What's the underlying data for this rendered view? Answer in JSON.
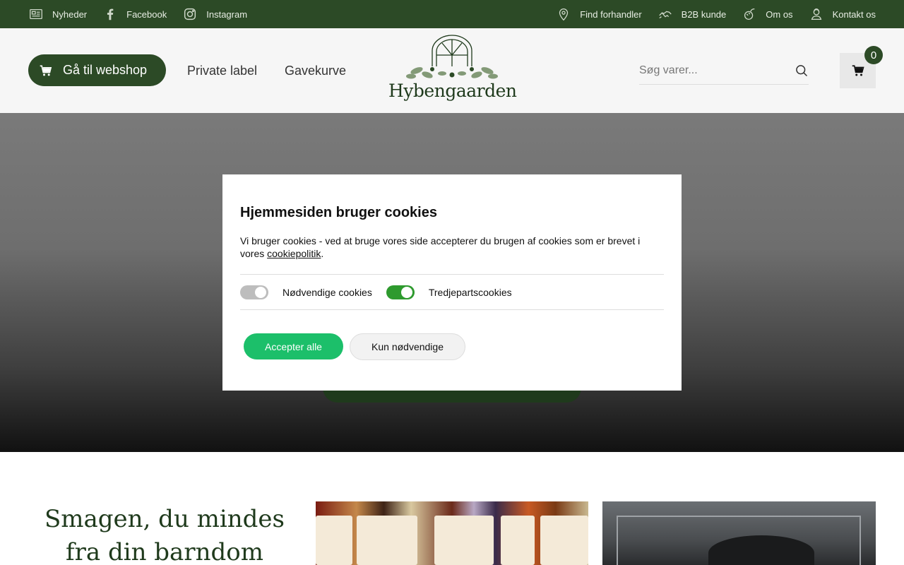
{
  "topbar": {
    "left_links": [
      {
        "label": "Nyheder",
        "icon": "newspaper-icon"
      },
      {
        "label": "Facebook",
        "icon": "facebook-icon"
      },
      {
        "label": "Instagram",
        "icon": "instagram-icon"
      }
    ],
    "right_links": [
      {
        "label": "Find forhandler",
        "icon": "location-pin-icon"
      },
      {
        "label": "B2B kunde",
        "icon": "handshake-icon"
      },
      {
        "label": "Om os",
        "icon": "rosehip-icon"
      },
      {
        "label": "Kontakt os",
        "icon": "contact-person-icon"
      }
    ]
  },
  "header": {
    "webshop_label": "Gå til webshop",
    "nav": [
      "Private label",
      "Gavekurve"
    ],
    "logo_text": "Hybengaarden",
    "search_placeholder": "Søg varer...",
    "cart_count": "0"
  },
  "cookie_modal": {
    "title": "Hjemmesiden bruger cookies",
    "description": "Vi bruger cookies - ved at bruge vores side accepterer du brugen af cookies som er brevet i vores ",
    "policy_link": "cookiepolitik",
    "period": ".",
    "toggle_necessary": "Nødvendige cookies",
    "toggle_third_party": "Tredjepartscookies",
    "accept_all": "Accepter alle",
    "only_necessary": "Kun nødvendige"
  },
  "main": {
    "headline": "Smagen, du mindes fra din barndom"
  },
  "colors": {
    "brand_green": "#2c4a26",
    "accept_green": "#1cbf6a",
    "toggle_on": "#2e9a2e"
  }
}
